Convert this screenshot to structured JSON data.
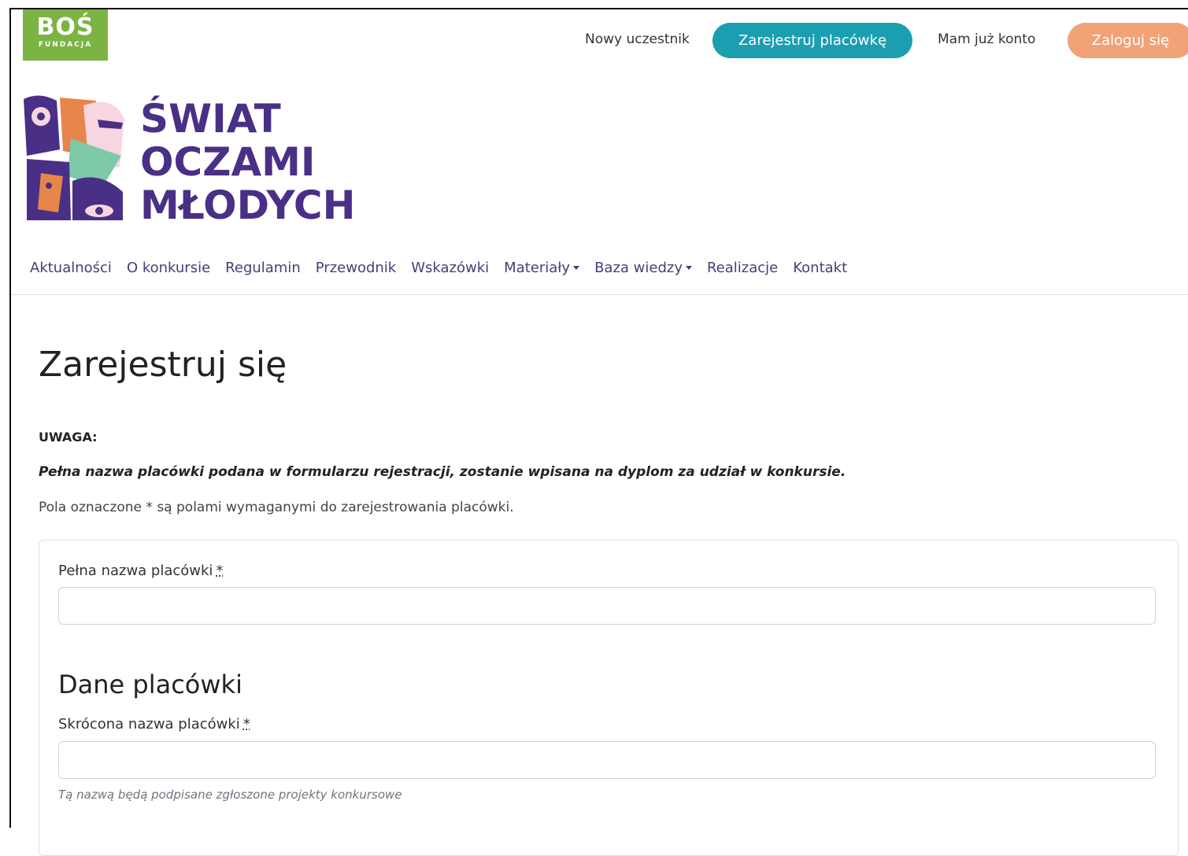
{
  "header": {
    "logo_big": "BOŚ",
    "logo_small": "FUNDACJA",
    "new_participant_label": "Nowy uczestnik",
    "register_button": "Zarejestruj placówkę",
    "have_account_label": "Mam już konto",
    "login_button": "Zaloguj się"
  },
  "brand": {
    "line1": "ŚWIAT",
    "line2": "OCZAMI",
    "line3": "MŁODYCH"
  },
  "nav": {
    "items": [
      {
        "label": "Aktualności"
      },
      {
        "label": "O konkursie"
      },
      {
        "label": "Regulamin"
      },
      {
        "label": "Przewodnik"
      },
      {
        "label": "Wskazówki"
      },
      {
        "label": "Materiały"
      },
      {
        "label": "Baza wiedzy"
      },
      {
        "label": "Realizacje"
      },
      {
        "label": "Kontakt"
      }
    ]
  },
  "main": {
    "title": "Zarejestruj się",
    "uwaga": "UWAGA:",
    "note_strong": "Pełna nazwa placówki podana w formularzu rejestracji, zostanie wpisana na dyplom za udział w konkursie.",
    "note": "Pola oznaczone * są polami wymaganymi do zarejestrowania placówki.",
    "form": {
      "full_name_label": "Pełna nazwa placówki",
      "required_mark": "*",
      "full_name_value": "",
      "section_title": "Dane placówki",
      "short_name_label": "Skrócona nazwa placówki",
      "short_name_value": "",
      "short_name_help": "Tą nazwą będą podpisane zgłoszone projekty konkursowe"
    }
  },
  "colors": {
    "brand_purple": "#4a2f86",
    "teal": "#1c9eb1",
    "orange": "#f1a377",
    "bos_green": "#7bb443"
  }
}
